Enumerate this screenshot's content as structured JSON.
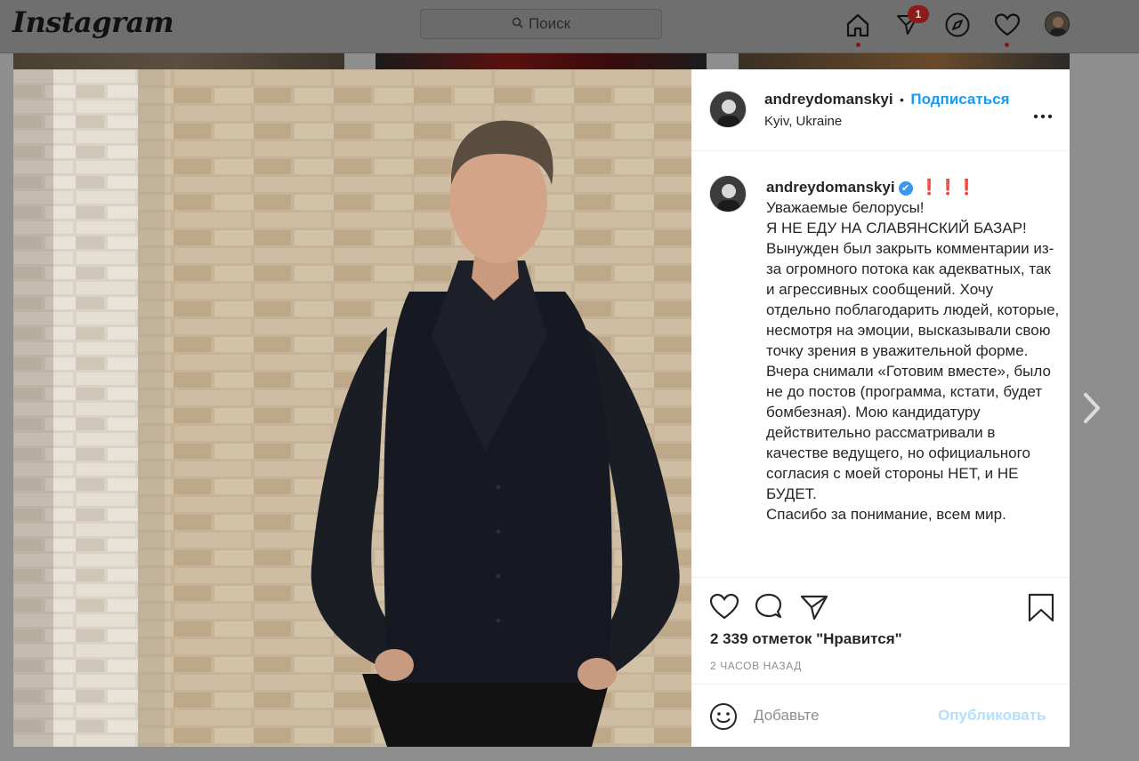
{
  "topbar": {
    "logo": "Instagram",
    "search_placeholder": "Поиск",
    "notification_count": "1",
    "icons": [
      "home-icon",
      "direct-icon",
      "explore-icon",
      "activity-heart-icon",
      "profile-avatar"
    ]
  },
  "post": {
    "header": {
      "username": "andreydomanskyi",
      "separator": "•",
      "follow_label": "Подписаться",
      "location": "Kyiv, Ukraine",
      "more_label": "•••"
    },
    "caption": {
      "username": "andreydomanskyi",
      "verified_mark": "✔",
      "emoji": "❗❗❗",
      "lines": [
        "Уважаемые белорусы!",
        "Я НЕ ЕДУ НА СЛАВЯНСКИЙ БАЗАР!",
        "Вынужден был закрыть комментарии из-за огромного потока как адекватных, так и агрессивных сообщений. Хочу отдельно поблагодарить людей, которые, несмотря на эмоции, высказывали свою точку зрения в уважительной форме. Вчера снимали «Готовим вместе», было не до постов (программа, кстати, будет бомбезная). Мою кандидатуру действительно рассматривали в качестве ведущего, но официального согласия с моей стороны НЕТ, и НЕ БУДЕТ.",
        "Спасибо за понимание, всем мир."
      ]
    },
    "likes": "2 339 отметок \"Нравится\"",
    "time_ago": "2 ЧАСОВ НАЗАД",
    "comment": {
      "placeholder": "Добавьте",
      "publish_label": "Опубликовать"
    }
  },
  "colors": {
    "accent": "#1a9bf0",
    "publish_disabled": "#b2dffc",
    "text": "#262626",
    "muted": "#8e8e8e",
    "overlay": "#8e8e8e"
  }
}
